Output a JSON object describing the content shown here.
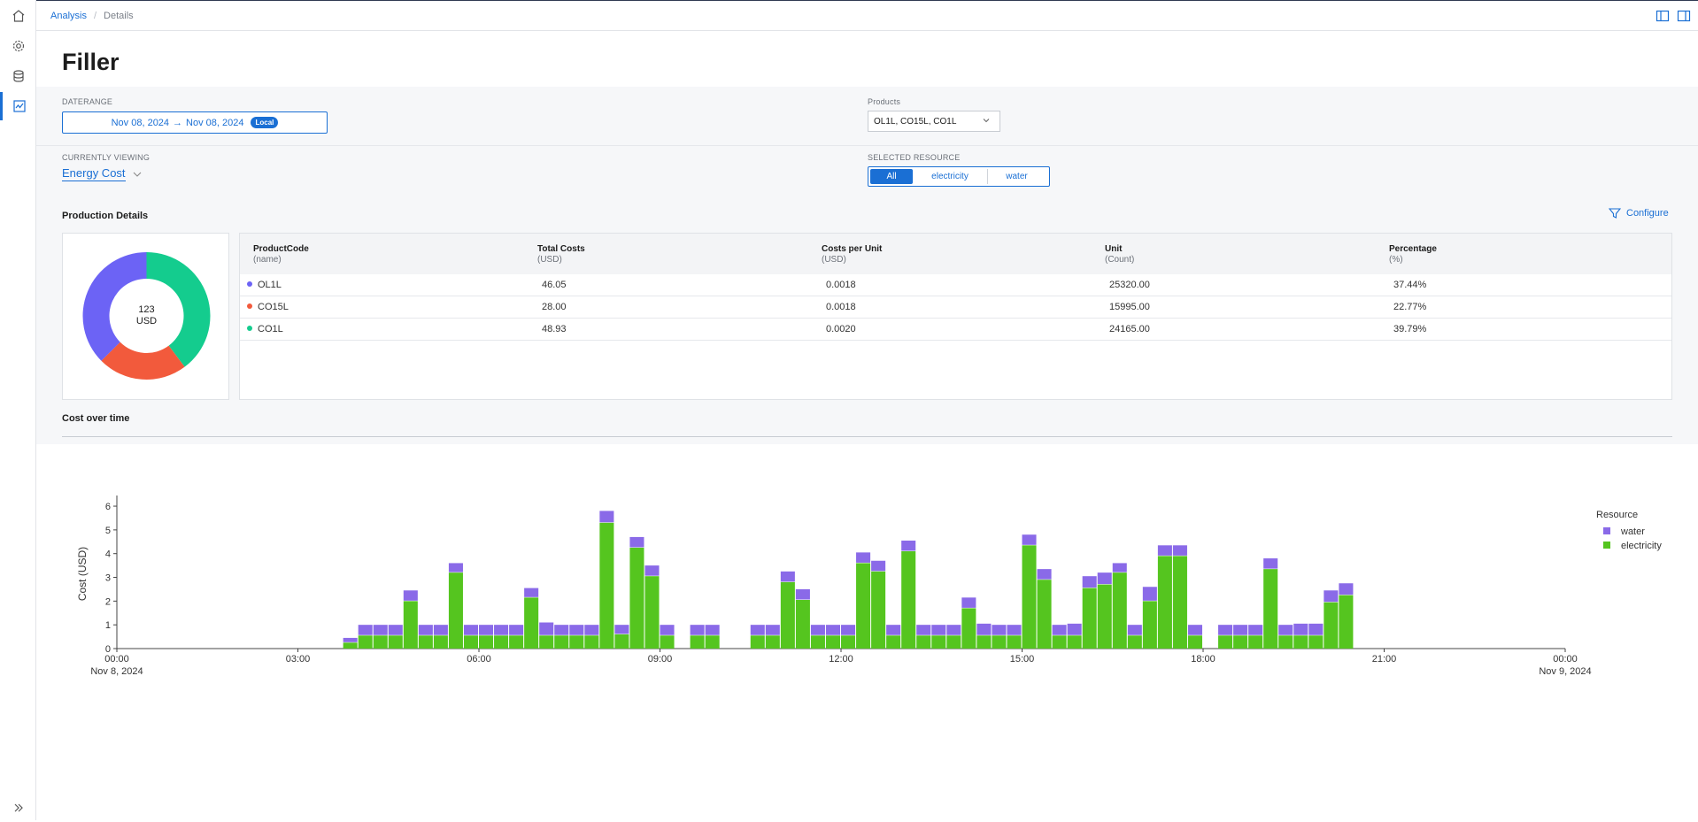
{
  "breadcrumb": {
    "root": "Analysis",
    "current": "Details"
  },
  "page": {
    "title": "Filler"
  },
  "filters": {
    "daterange_label": "DATERANGE",
    "date_from": "Nov 08, 2024",
    "arrow": "→",
    "date_to": "Nov 08, 2024",
    "tz_badge": "Local",
    "products_label": "Products",
    "products_value": "OL1L, CO15L, CO1L",
    "viewing_label": "CURRENTLY VIEWING",
    "viewing_value": "Energy Cost",
    "resource_label": "SELECTED RESOURCE",
    "resource_options": [
      "All",
      "electricity",
      "water"
    ],
    "resource_selected": "All"
  },
  "production": {
    "title": "Production Details",
    "configure_label": "Configure",
    "donut_value": "123",
    "donut_unit": "USD",
    "columns": [
      {
        "name": "ProductCode",
        "sub": "(name)"
      },
      {
        "name": "Total Costs",
        "sub": "(USD)"
      },
      {
        "name": "Costs per Unit",
        "sub": "(USD)"
      },
      {
        "name": "Unit",
        "sub": "(Count)"
      },
      {
        "name": "Percentage",
        "sub": "(%)"
      }
    ],
    "rows": [
      {
        "code": "OL1L",
        "total": "46.05",
        "per_unit": "0.0018",
        "unit": "25320.00",
        "pct": "37.44%",
        "color": "#6c63f5"
      },
      {
        "code": "CO15L",
        "total": "28.00",
        "per_unit": "0.0018",
        "unit": "15995.00",
        "pct": "22.77%",
        "color": "#f25a3c"
      },
      {
        "code": "CO1L",
        "total": "48.93",
        "per_unit": "0.0020",
        "unit": "24165.00",
        "pct": "39.79%",
        "color": "#14cc8e"
      }
    ]
  },
  "cost_section": {
    "title": "Cost over time"
  },
  "colors": {
    "accent": "#1a6fd4",
    "water": "#8a6ae8",
    "electricity": "#55c51f"
  },
  "chart_data": [
    {
      "type": "pie",
      "categories": [
        "OL1L",
        "CO15L",
        "CO1L"
      ],
      "values": [
        46.05,
        28.0,
        48.93
      ],
      "colors": [
        "#6c63f5",
        "#f25a3c",
        "#14cc8e"
      ],
      "center_text": "123 USD"
    },
    {
      "type": "bar",
      "stacked": true,
      "x_start": "2024-11-08T03:45",
      "x_step_minutes": 15,
      "series": [
        {
          "name": "electricity",
          "values": [
            0.25,
            0.55,
            0.55,
            0.55,
            2.0,
            0.55,
            0.55,
            3.2,
            0.55,
            0.55,
            0.55,
            0.55,
            2.15,
            0.55,
            0.55,
            0.55,
            0.55,
            5.3,
            0.6,
            4.25,
            3.05,
            0.55,
            0,
            0.55,
            0.55,
            0,
            0,
            0.55,
            0.55,
            2.8,
            2.05,
            0.55,
            0.55,
            0.55,
            3.6,
            3.25,
            0.55,
            4.1,
            0.55,
            0.55,
            0.55,
            1.7,
            0.55,
            0.55,
            0.55,
            4.35,
            2.9,
            0.55,
            0.55,
            2.55,
            2.7,
            3.2,
            0.55,
            2.0,
            3.9,
            3.9,
            0.55,
            0,
            0.55,
            0.55,
            0.55,
            3.35,
            0.55,
            0.55,
            0.55,
            1.95,
            2.25
          ],
          "color": "#55c51f"
        },
        {
          "name": "water",
          "values": [
            0.2,
            0.45,
            0.45,
            0.45,
            0.45,
            0.45,
            0.45,
            0.4,
            0.45,
            0.45,
            0.45,
            0.45,
            0.4,
            0.55,
            0.45,
            0.45,
            0.45,
            0.5,
            0.4,
            0.45,
            0.45,
            0.45,
            0,
            0.45,
            0.45,
            0,
            0,
            0.45,
            0.45,
            0.45,
            0.45,
            0.45,
            0.45,
            0.45,
            0.45,
            0.45,
            0.45,
            0.45,
            0.45,
            0.45,
            0.45,
            0.45,
            0.5,
            0.45,
            0.45,
            0.45,
            0.45,
            0.45,
            0.5,
            0.5,
            0.5,
            0.4,
            0.45,
            0.6,
            0.45,
            0.45,
            0.45,
            0,
            0.45,
            0.45,
            0.45,
            0.45,
            0.45,
            0.5,
            0.5,
            0.5,
            0.5
          ],
          "color": "#8a6ae8"
        }
      ],
      "xlabel": "",
      "ylabel": "Cost (USD)",
      "ylim": [
        0,
        6.3
      ],
      "y_ticks": [
        "0",
        "1",
        "2",
        "3",
        "4",
        "5",
        "6"
      ],
      "x_ticks": [
        "00:00",
        "03:00",
        "06:00",
        "09:00",
        "12:00",
        "15:00",
        "18:00",
        "21:00",
        "00:00"
      ],
      "x_tick_sublabels": [
        "Nov 8, 2024",
        "",
        "",
        "",
        "",
        "",
        "",
        "",
        "Nov 9, 2024"
      ],
      "legend_title": "Resource",
      "legend": [
        "water",
        "electricity"
      ],
      "legend_position": "right"
    }
  ]
}
